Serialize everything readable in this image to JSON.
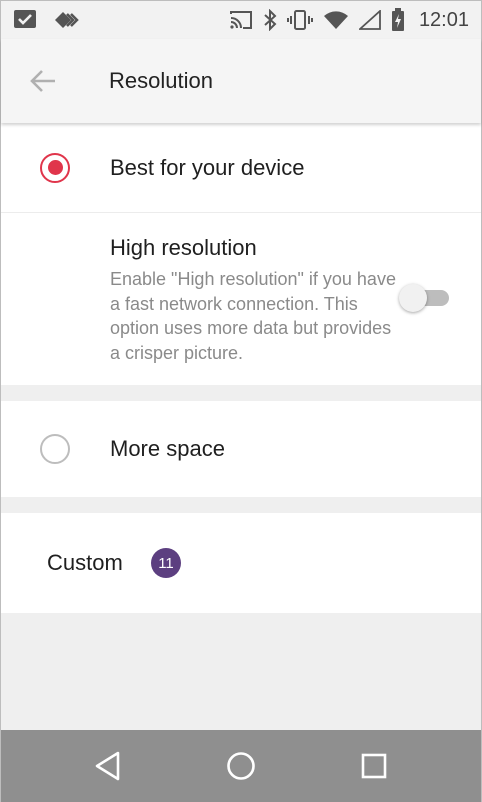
{
  "status_bar": {
    "time": "12:01",
    "icons": [
      "checkbox-notification-icon",
      "diamond-arrows-icon",
      "cast-icon",
      "bluetooth-icon",
      "vibrate-icon",
      "wifi-icon",
      "signal-icon",
      "battery-charging-icon"
    ]
  },
  "app_bar": {
    "title": "Resolution",
    "back_icon": "arrow-left-icon"
  },
  "options": {
    "best": {
      "label": "Best for your device",
      "selected": true
    },
    "high": {
      "title": "High resolution",
      "description": "Enable \"High resolution\" if you have a fast network connection. This option uses more data but provides a crisper picture.",
      "toggle_on": false
    },
    "more_space": {
      "label": "More space",
      "selected": false
    },
    "custom": {
      "label": "Custom",
      "badge": "11"
    }
  },
  "colors": {
    "accent": "#e0354b",
    "badge": "#5c3f80",
    "nav_bar": "#8f8f8f"
  },
  "nav_bar": {
    "buttons": [
      "back-triangle-icon",
      "home-circle-icon",
      "recents-square-icon"
    ]
  }
}
